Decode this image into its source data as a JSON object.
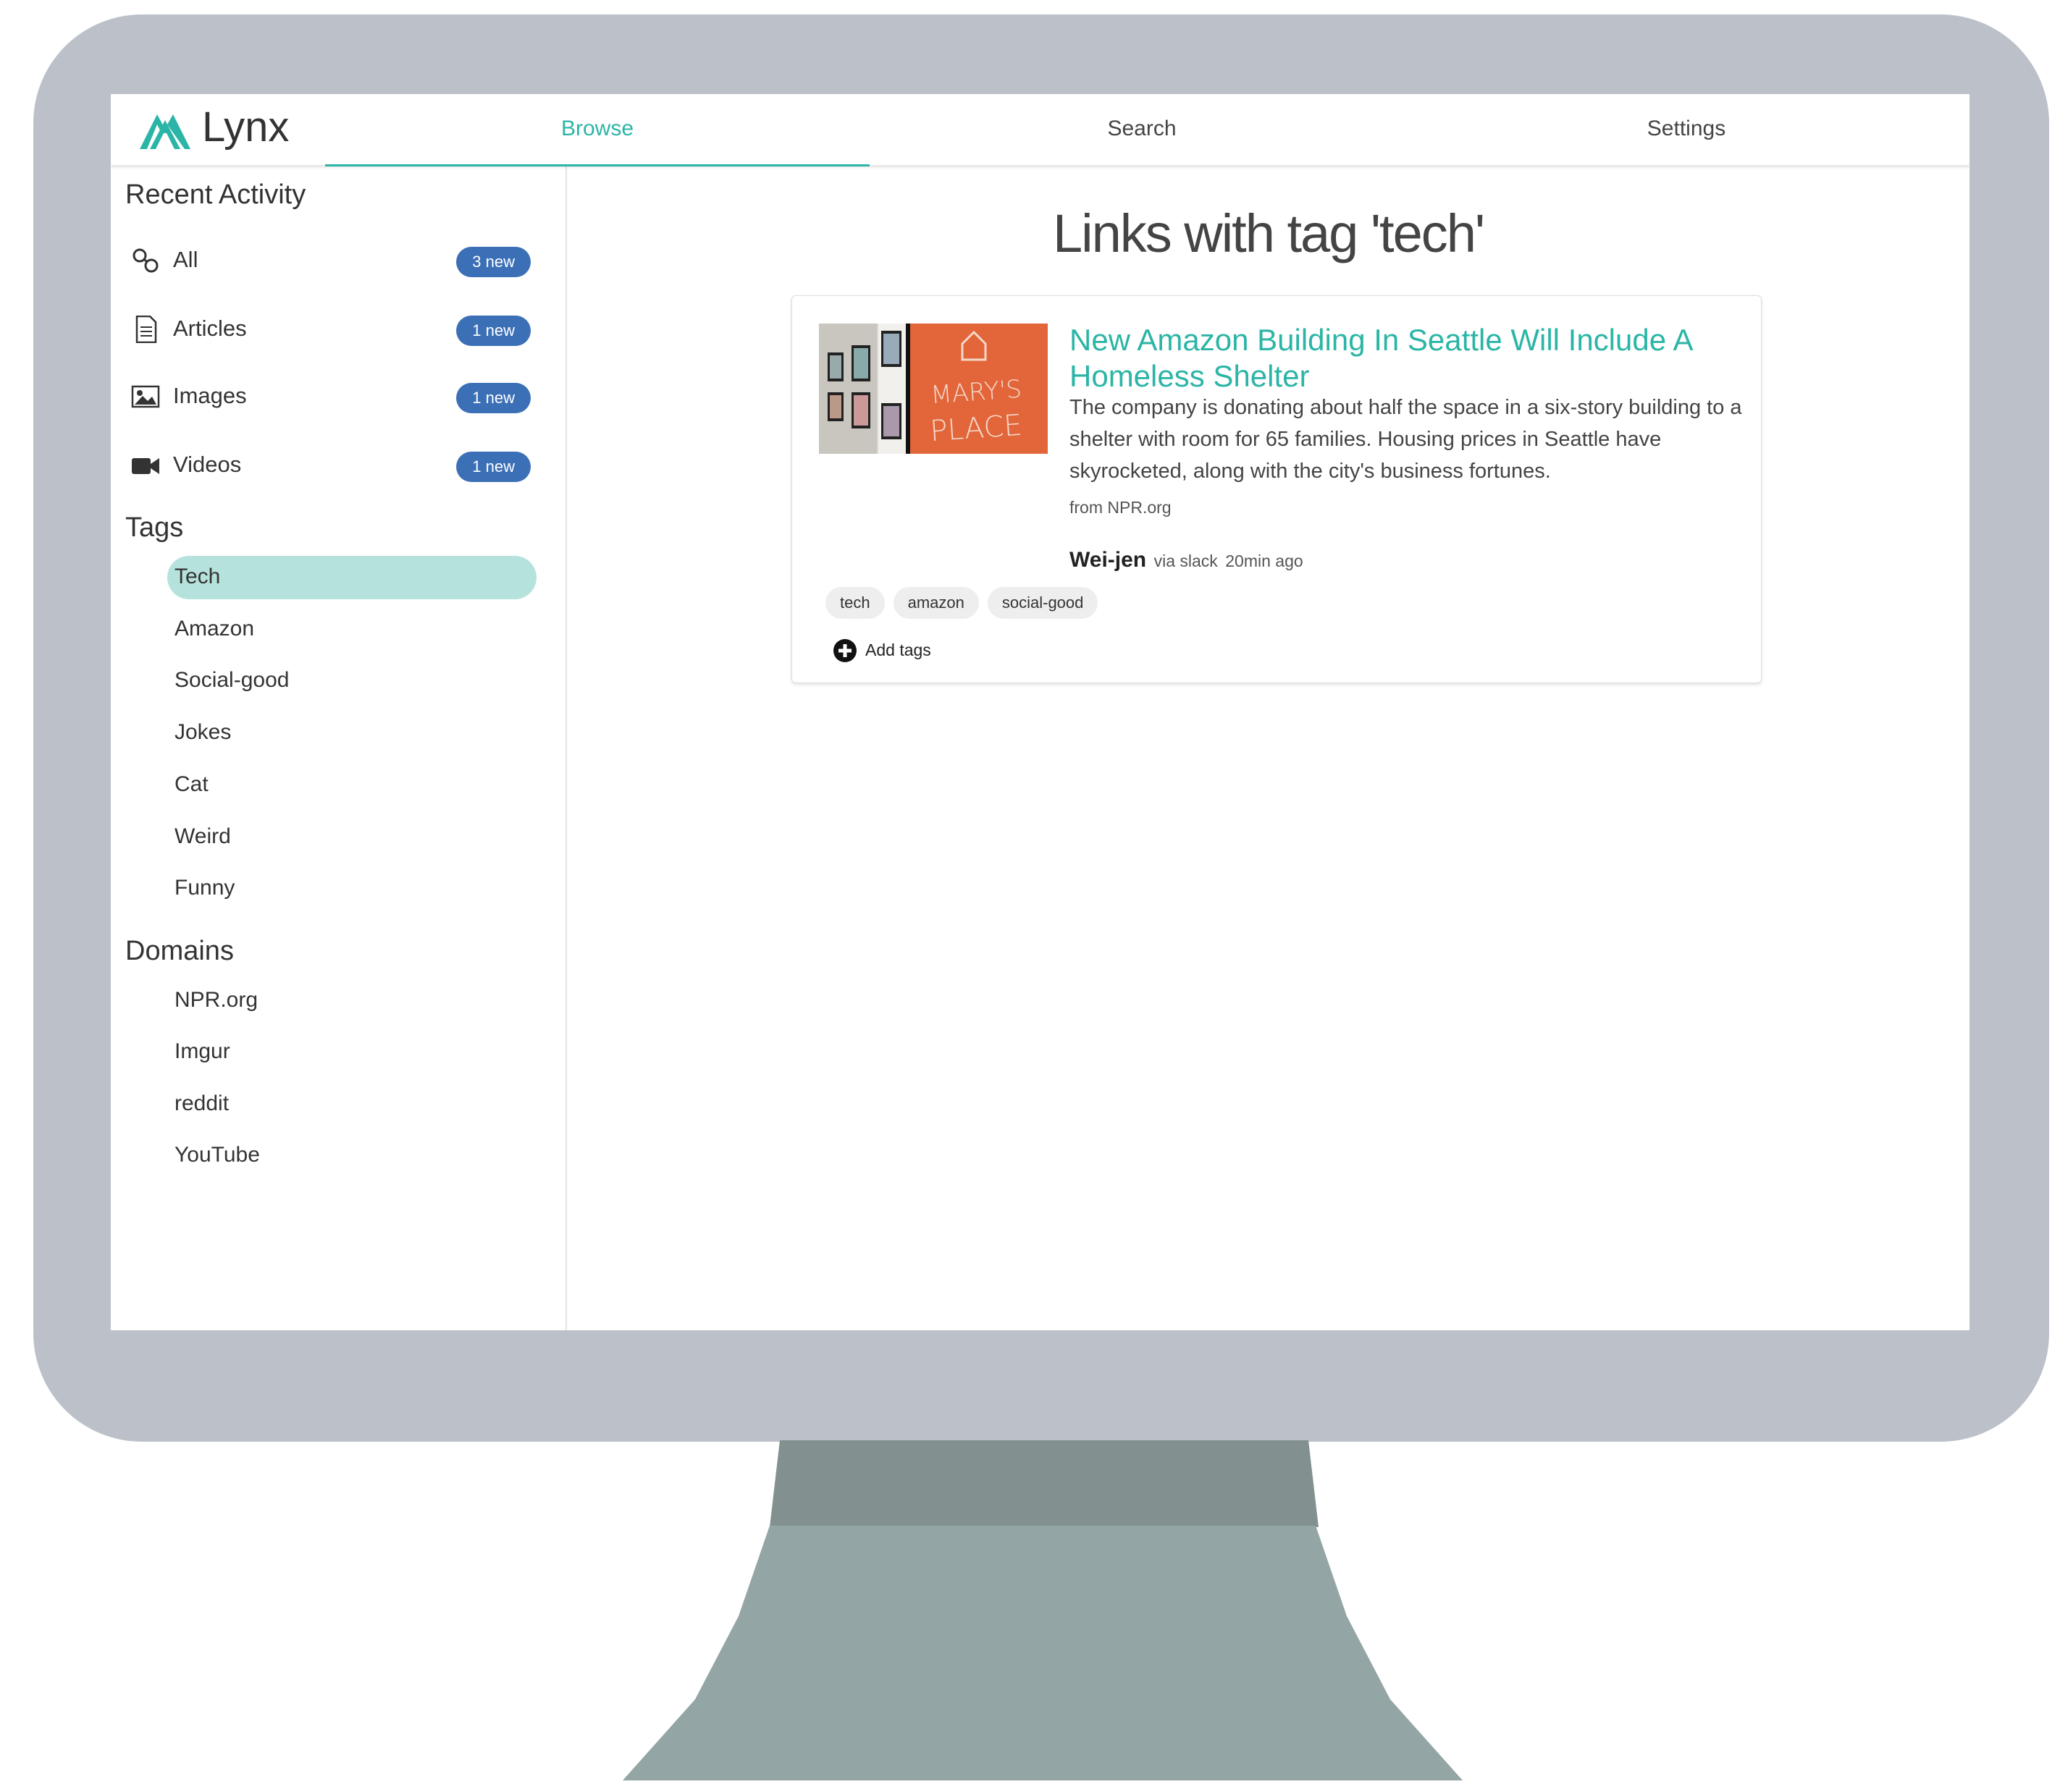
{
  "app": {
    "name": "Lynx"
  },
  "nav": {
    "tabs": [
      {
        "label": "Browse",
        "active": true
      },
      {
        "label": "Search",
        "active": false
      },
      {
        "label": "Settings",
        "active": false
      }
    ]
  },
  "sidebar": {
    "recent_title": "Recent Activity",
    "recent": [
      {
        "icon": "link-icon",
        "label": "All",
        "badge": "3 new"
      },
      {
        "icon": "document-icon",
        "label": "Articles",
        "badge": "1 new"
      },
      {
        "icon": "image-icon",
        "label": "Images",
        "badge": "1 new"
      },
      {
        "icon": "video-camera-icon",
        "label": "Videos",
        "badge": "1 new"
      }
    ],
    "tags_title": "Tags",
    "tags": [
      "Tech",
      "Amazon",
      "Social-good",
      "Jokes",
      "Cat",
      "Weird",
      "Funny"
    ],
    "selected_tag": "Tech",
    "domains_title": "Domains",
    "domains": [
      "NPR.org",
      "Imgur",
      "reddit",
      "YouTube"
    ]
  },
  "main": {
    "title": "Links with tag 'tech'",
    "link": {
      "title": "New Amazon Building In Seattle Will Include A Homeless Shelter",
      "description": "The company is donating about half the space in a six-story building to a shelter with room for 65 families. Housing prices in Seattle have skyrocketed, along with the city's business fortunes.",
      "source": "from NPR.org",
      "author": "Wei-jen",
      "via": "via slack",
      "time": "20min ago",
      "image_text": [
        "MARY'S",
        "PLACE"
      ],
      "tags": [
        "tech",
        "amazon",
        "social-good"
      ],
      "add_tags_label": "Add tags"
    }
  },
  "colors": {
    "accent": "#2bb5a6",
    "badge": "#3b6fb6",
    "selected_tag_bg": "#b6e2dd",
    "bezel": "#bcc1c9",
    "stand": "#93a5a4"
  }
}
